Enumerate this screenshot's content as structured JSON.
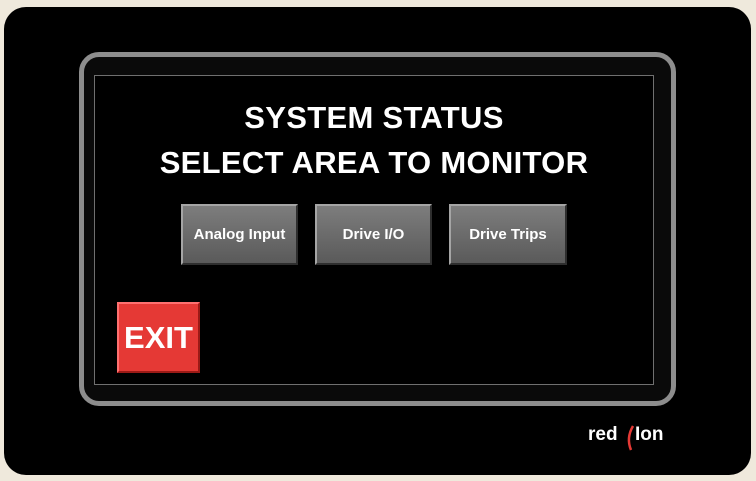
{
  "screen": {
    "title_line1": "SYSTEM STATUS",
    "title_line2": "SELECT AREA TO MONITOR"
  },
  "buttons": [
    {
      "label": "Analog Input"
    },
    {
      "label": "Drive I/O"
    },
    {
      "label": "Drive Trips"
    }
  ],
  "exit_button": {
    "label": "EXIT",
    "color": "#e53935"
  },
  "logo": {
    "text_left": "red",
    "text_right": "I⁠on",
    "icon": "red-lion-logo-icon",
    "accent": "#e53935"
  }
}
